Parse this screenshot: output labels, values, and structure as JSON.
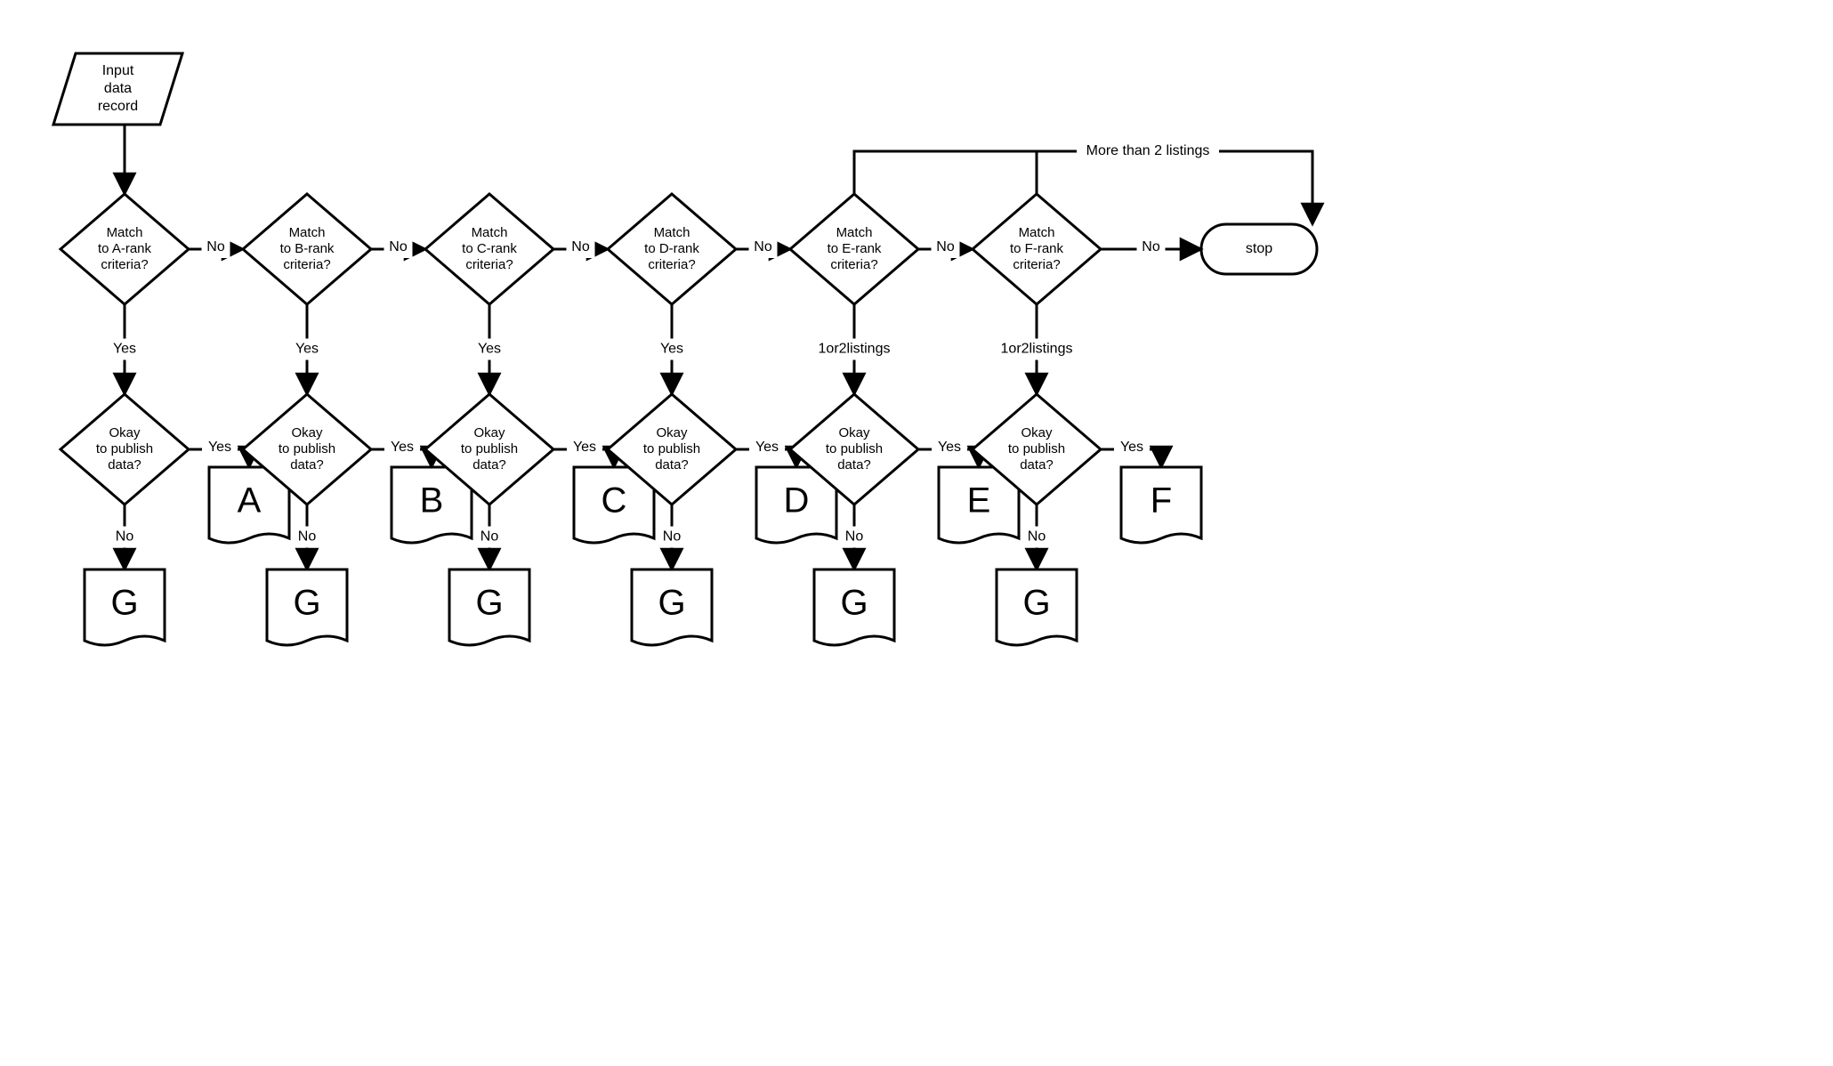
{
  "input_node": {
    "line1": "Input",
    "line2": "data",
    "line3": "record"
  },
  "terminator": {
    "label": "stop"
  },
  "loop_label": "More than 2 listings",
  "columns": [
    {
      "match": {
        "line1": "Match",
        "line2": "to A-rank",
        "line3": "criteria?"
      },
      "match_no": "No",
      "match_yes": "Yes",
      "publish": {
        "line1": "Okay",
        "line2": "to publish",
        "line3": "data?"
      },
      "publish_yes": "Yes",
      "publish_no": "No",
      "doc_yes": "A",
      "doc_no": "G"
    },
    {
      "match": {
        "line1": "Match",
        "line2": "to B-rank",
        "line3": "criteria?"
      },
      "match_no": "No",
      "match_yes": "Yes",
      "publish": {
        "line1": "Okay",
        "line2": "to publish",
        "line3": "data?"
      },
      "publish_yes": "Yes",
      "publish_no": "No",
      "doc_yes": "B",
      "doc_no": "G"
    },
    {
      "match": {
        "line1": "Match",
        "line2": "to C-rank",
        "line3": "criteria?"
      },
      "match_no": "No",
      "match_yes": "Yes",
      "publish": {
        "line1": "Okay",
        "line2": "to publish",
        "line3": "data?"
      },
      "publish_yes": "Yes",
      "publish_no": "No",
      "doc_yes": "C",
      "doc_no": "G"
    },
    {
      "match": {
        "line1": "Match",
        "line2": "to D-rank",
        "line3": "criteria?"
      },
      "match_no": "No",
      "match_yes": "Yes",
      "publish": {
        "line1": "Okay",
        "line2": "to publish",
        "line3": "data?"
      },
      "publish_yes": "Yes",
      "publish_no": "No",
      "doc_yes": "D",
      "doc_no": "G"
    },
    {
      "match": {
        "line1": "Match",
        "line2": "to E-rank",
        "line3": "criteria?"
      },
      "match_no": "No",
      "match_yes": "1or2listings",
      "publish": {
        "line1": "Okay",
        "line2": "to publish",
        "line3": "data?"
      },
      "publish_yes": "Yes",
      "publish_no": "No",
      "doc_yes": "E",
      "doc_no": "G"
    },
    {
      "match": {
        "line1": "Match",
        "line2": "to F-rank",
        "line3": "criteria?"
      },
      "match_no": "No",
      "match_yes": "1or2listings",
      "publish": {
        "line1": "Okay",
        "line2": "to publish",
        "line3": "data?"
      },
      "publish_yes": "Yes",
      "publish_no": "No",
      "doc_yes": "F",
      "doc_no": "G"
    }
  ]
}
